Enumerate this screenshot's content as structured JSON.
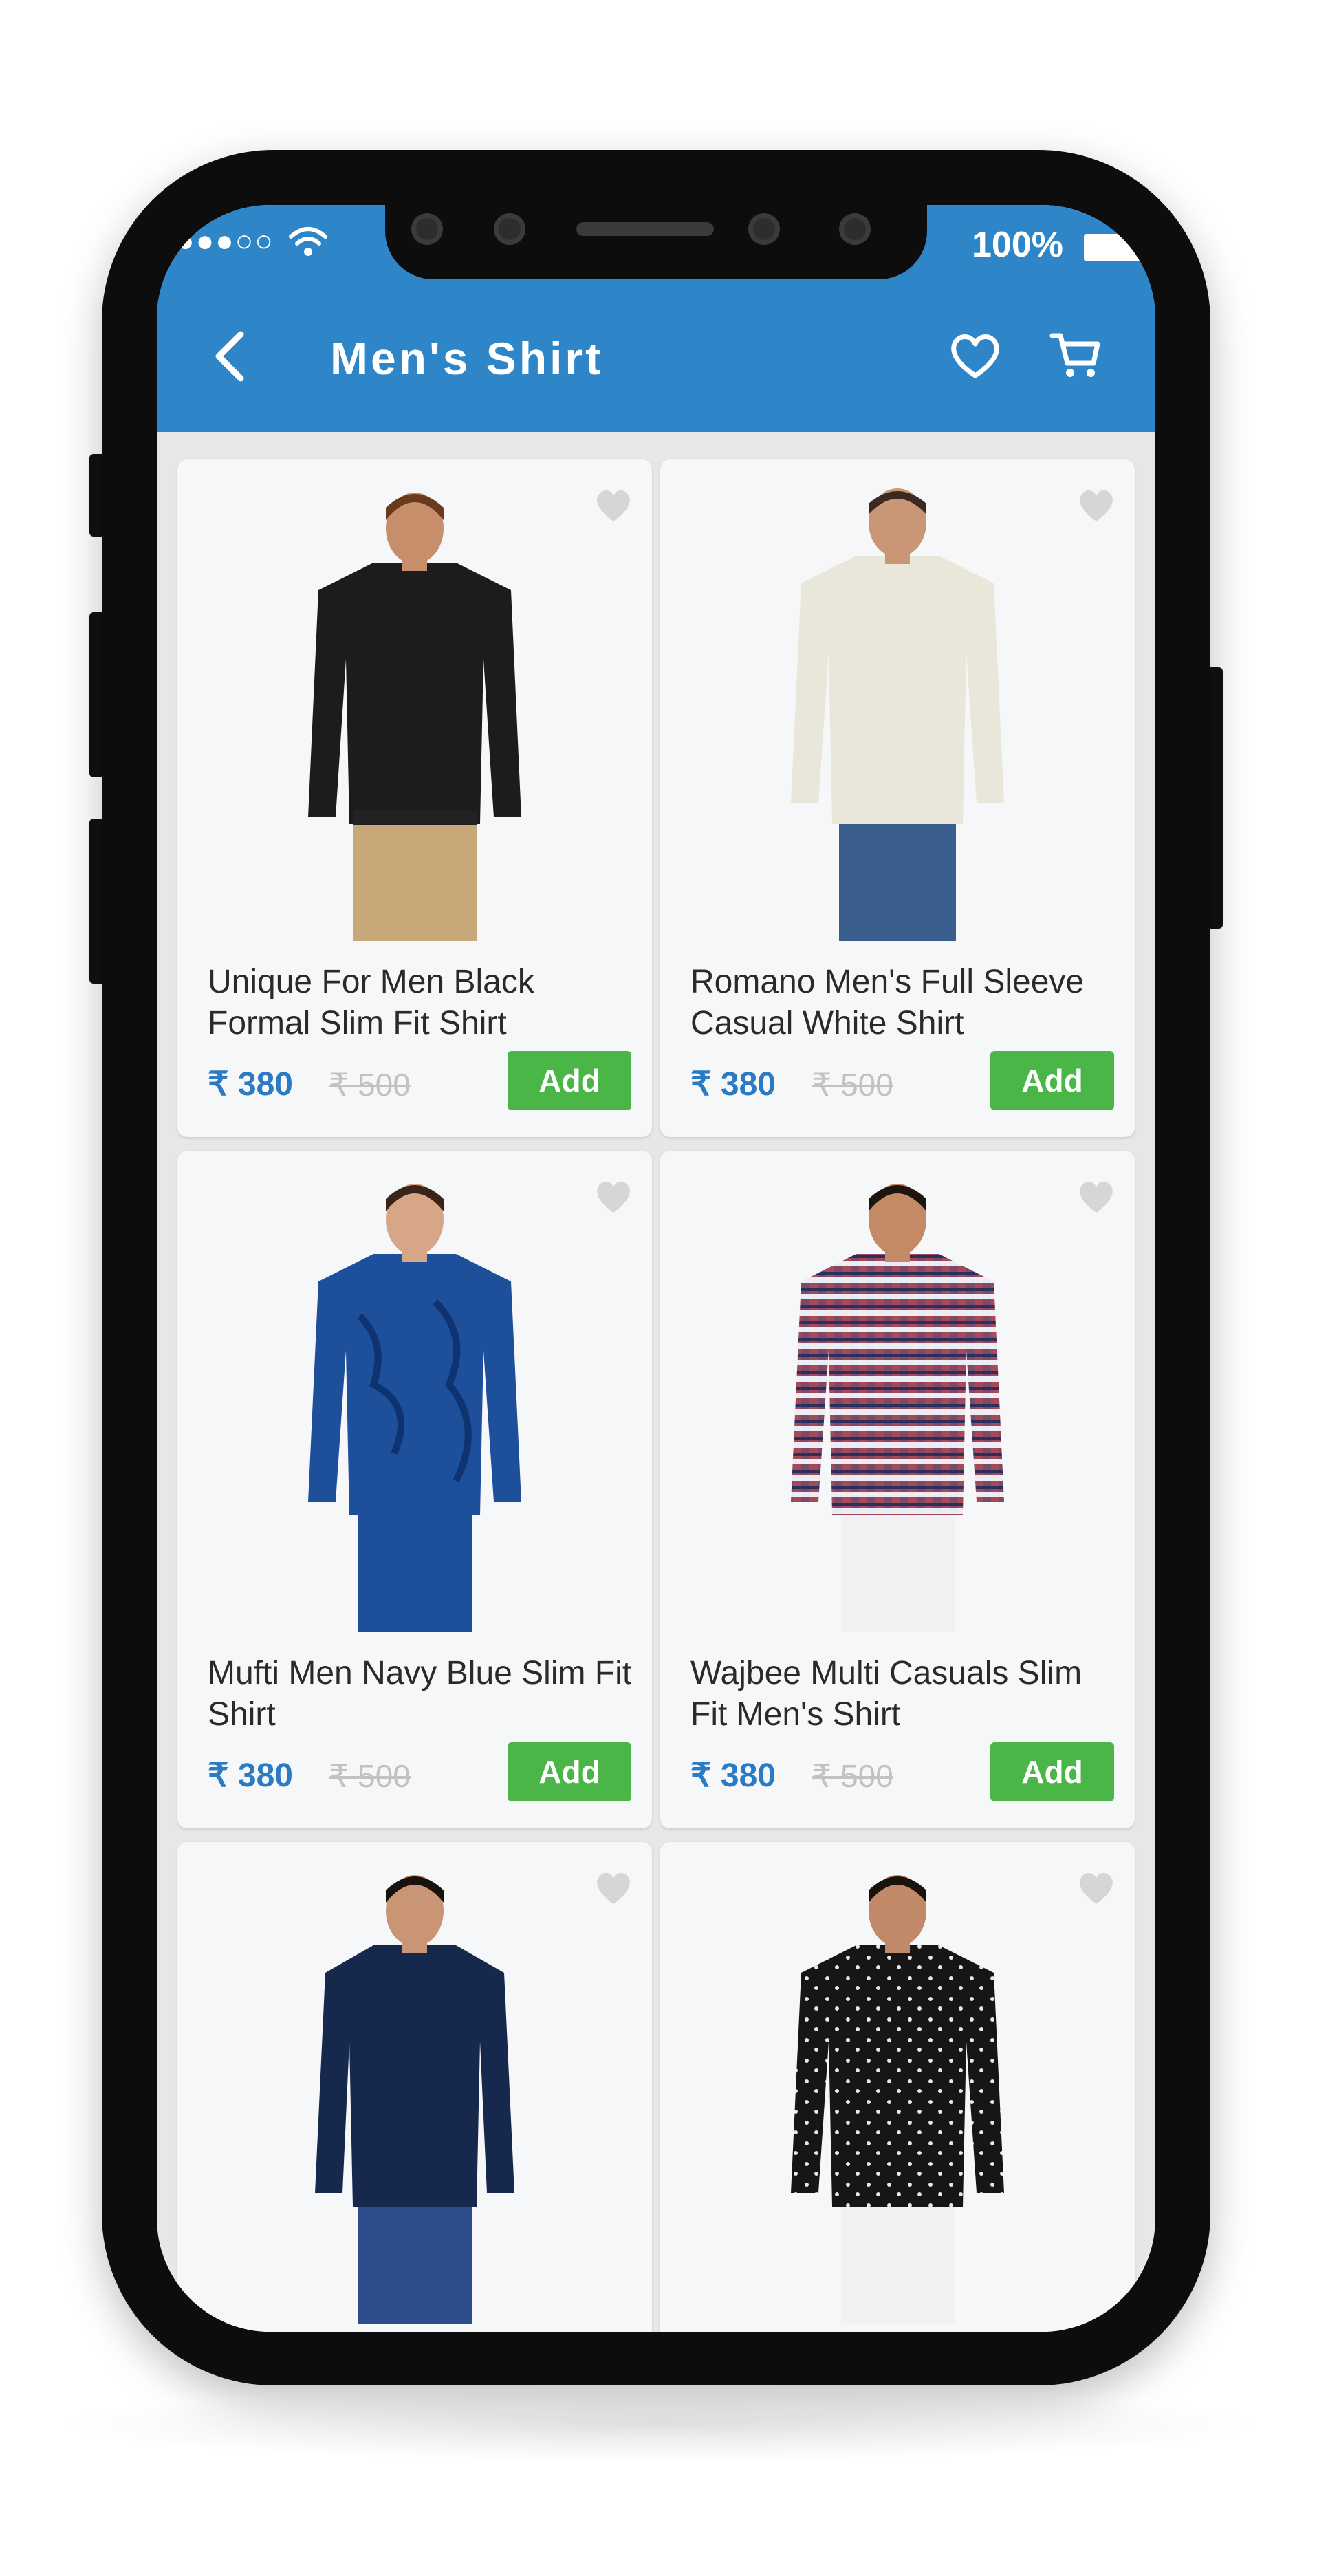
{
  "status_bar": {
    "signal": "●●●○○",
    "battery": "100%"
  },
  "header": {
    "title": "Men's Shirt",
    "back_icon": "chevron-left-icon",
    "wishlist_icon": "heart-outline-icon",
    "cart_icon": "cart-icon"
  },
  "products": [
    {
      "name": "Unique For Men Black Formal Slim Fit Shirt",
      "price": "₹ 380",
      "mrp": "₹ 500",
      "add": "Add",
      "shirt_color": "#1c1c1c",
      "pants_color": "#c8a878"
    },
    {
      "name": "Romano Men's Full Sleeve Casual White Shirt",
      "price": "₹ 380",
      "mrp": "₹ 500",
      "add": "Add",
      "shirt_color": "#e9e6da",
      "pants_color": "#3a5e8e"
    },
    {
      "name": "Mufti Men Navy Blue Slim Fit Shirt",
      "price": "₹ 380",
      "mrp": "₹ 500",
      "add": "Add",
      "shirt_color": "#1d4f9a",
      "pants_color": "#1d4f9a"
    },
    {
      "name": "Wajbee Multi Casuals Slim Fit Men's Shirt",
      "price": "₹ 380",
      "mrp": "₹ 500",
      "add": "Add",
      "shirt_color": "#7a4a66",
      "pants_color": "#f1f1f1"
    },
    {
      "name": "",
      "price": "",
      "mrp": "",
      "add": "",
      "shirt_color": "#16294c",
      "pants_color": "#2d4d8c"
    },
    {
      "name": "",
      "price": "",
      "mrp": "",
      "add": "",
      "shirt_color": "#161616",
      "pants_color": "#f2f2f2"
    }
  ],
  "colors": {
    "header_blue": "#2e86c8",
    "price_blue": "#2a7ac4",
    "add_green": "#4ab648"
  }
}
